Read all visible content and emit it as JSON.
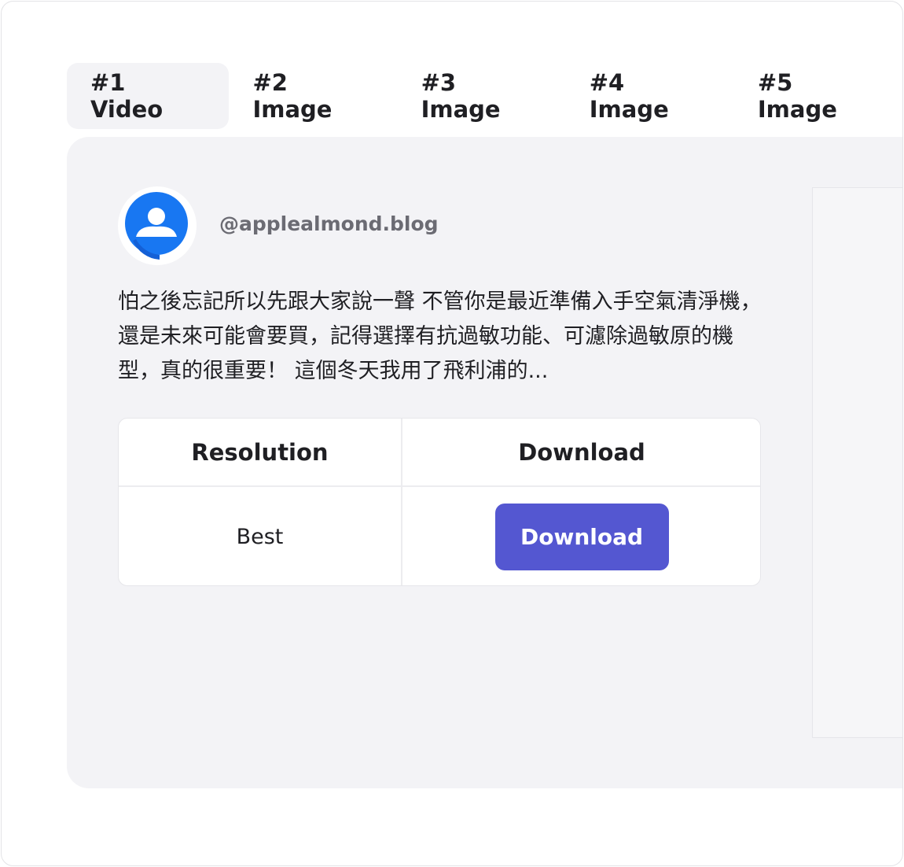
{
  "tabs": [
    {
      "label": "#1 Video",
      "active": true
    },
    {
      "label": "#2 Image",
      "active": false
    },
    {
      "label": "#3 Image",
      "active": false
    },
    {
      "label": "#4 Image",
      "active": false
    },
    {
      "label": "#5 Image",
      "active": false
    }
  ],
  "post": {
    "avatar_icon": "user-avatar-icon",
    "username": "@applealmond.blog",
    "caption": "怕之後忘記所以先跟大家說一聲 不管你是最近準備入手空氣清淨機，還是未來可能會要買，記得選擇有抗過敏功能、可濾除過敏原的機型，真的很重要！ 這個冬天我用了飛利浦的..."
  },
  "table": {
    "headers": {
      "resolution": "Resolution",
      "download": "Download"
    },
    "rows": [
      {
        "resolution": "Best",
        "download_label": "Download"
      }
    ]
  },
  "colors": {
    "accent": "#5457d1",
    "avatar": "#1877f2",
    "panel": "#f3f3f6"
  }
}
